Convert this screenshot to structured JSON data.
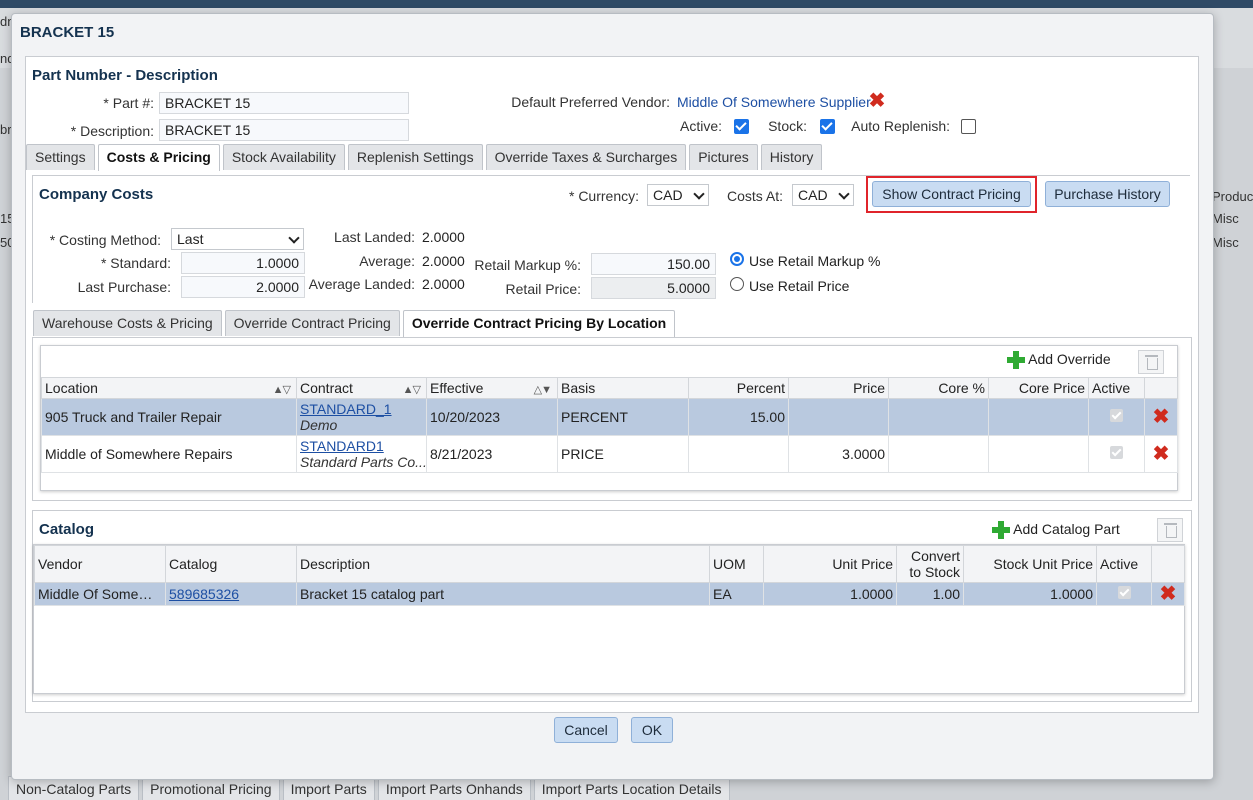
{
  "background": {
    "fragments": [
      "dn",
      "nda",
      "br",
      "15",
      "50"
    ],
    "right_header": "Produc",
    "right_rows": [
      "Misc",
      "Misc"
    ],
    "bottom_tabs": [
      "Non-Catalog Parts",
      "Promotional Pricing",
      "Import Parts",
      "Import Parts Onhands",
      "Import Parts Location Details"
    ]
  },
  "dialog": {
    "title": "BRACKET 15",
    "ok_label": "OK",
    "cancel_label": "Cancel"
  },
  "part": {
    "section_title": "Part Number - Description",
    "part_no_label": "Part #:",
    "part_no_value": "BRACKET 15",
    "description_label": "Description:",
    "description_value": "BRACKET 15",
    "required_mark": "*",
    "vendor_label": "Default Preferred Vendor:",
    "vendor_value": "Middle Of Somewhere Supplier",
    "active_label": "Active:",
    "active": true,
    "stock_label": "Stock:",
    "stock": true,
    "auto_replenish_label": "Auto Replenish:",
    "auto_replenish": false
  },
  "main_tabs": [
    "Settings",
    "Costs & Pricing",
    "Stock Availability",
    "Replenish Settings",
    "Override Taxes & Surcharges",
    "Pictures",
    "History"
  ],
  "main_tab_active": "Costs & Pricing",
  "company_costs": {
    "title": "Company Costs",
    "currency_label": "Currency:",
    "currency_value": "CAD",
    "costs_at_label": "Costs At:",
    "costs_at_value": "CAD",
    "show_contract_pricing": "Show Contract Pricing",
    "purchase_history": "Purchase History",
    "costing_method_label": "Costing Method:",
    "costing_method_value": "Last",
    "standard_label": "Standard:",
    "standard_value": "1.0000",
    "last_purchase_label": "Last Purchase:",
    "last_purchase_value": "2.0000",
    "last_landed_label": "Last Landed:",
    "last_landed_value": "2.0000",
    "average_label": "Average:",
    "average_value": "2.0000",
    "average_landed_label": "Average Landed:",
    "average_landed_value": "2.0000",
    "retail_markup_label": "Retail Markup %:",
    "retail_markup_value": "150.00",
    "retail_price_label": "Retail Price:",
    "retail_price_value": "5.0000",
    "use_markup_label": "Use Retail Markup %",
    "use_price_label": "Use Retail Price"
  },
  "sub_tabs": [
    "Warehouse Costs & Pricing",
    "Override Contract Pricing",
    "Override Contract Pricing By Location"
  ],
  "sub_tab_active": "Override Contract Pricing By Location",
  "overrides": {
    "add_label": "Add Override",
    "columns": [
      "Location",
      "Contract",
      "Effective",
      "Basis",
      "Percent",
      "Price",
      "Core %",
      "Core Price",
      "Active"
    ],
    "rows": [
      {
        "location": "905 Truck and Trailer Repair",
        "contract": "STANDARD_1",
        "contract_sub": "Demo",
        "effective": "10/20/2023",
        "basis": "PERCENT",
        "percent": "15.00",
        "price": "",
        "core_pct": "",
        "core_price": ""
      },
      {
        "location": "Middle of Somewhere Repairs",
        "contract": "STANDARD1",
        "contract_sub": "Standard Parts Co...",
        "effective": "8/21/2023",
        "basis": "PRICE",
        "percent": "",
        "price": "3.0000",
        "core_pct": "",
        "core_price": ""
      }
    ]
  },
  "catalog": {
    "title": "Catalog",
    "add_label": "Add Catalog Part",
    "columns": [
      "Vendor",
      "Catalog",
      "Description",
      "UOM",
      "Unit Price",
      "Convert",
      "to Stock",
      "Stock Unit Price",
      "Active"
    ],
    "rows": [
      {
        "vendor": "Middle Of Somewh...",
        "catalog": "589685326",
        "description": "Bracket 15 catalog part",
        "uom": "EA",
        "unit_price": "1.0000",
        "convert": "1.00",
        "stock_unit_price": "1.0000"
      }
    ]
  }
}
